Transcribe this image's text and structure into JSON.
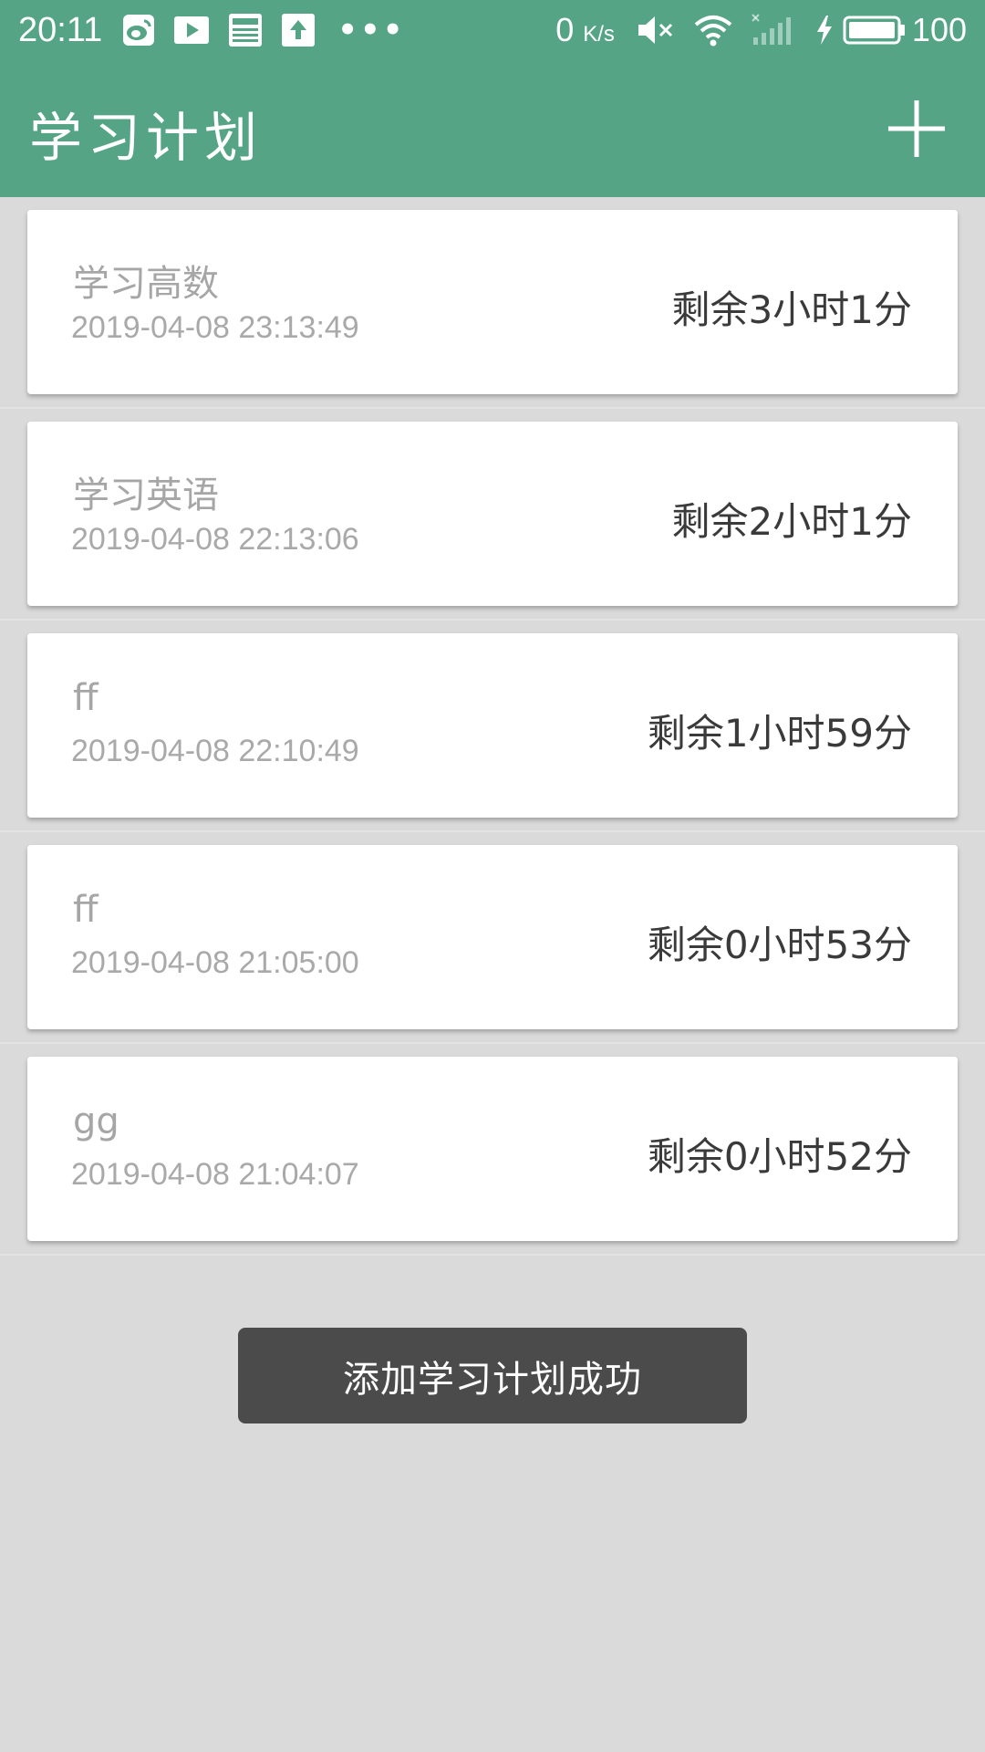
{
  "status_bar": {
    "time": "20:11",
    "icons_left": [
      "weibo-icon",
      "video-icon",
      "news-icon",
      "upload-icon"
    ],
    "more": "•••",
    "net_speed_value": "0",
    "net_speed_unit": "K/s",
    "icons_right": [
      "mute-icon",
      "wifi-icon",
      "signal-icon",
      "charging-icon",
      "battery-icon"
    ],
    "battery": "100"
  },
  "app_bar": {
    "title": "学习计划",
    "add_icon": "plus-icon"
  },
  "plans": [
    {
      "title": "学习高数",
      "time": "2019-04-08 23:13:49",
      "remaining": "剩余3小时1分"
    },
    {
      "title": "学习英语",
      "time": "2019-04-08 22:13:06",
      "remaining": "剩余2小时1分"
    },
    {
      "title": "ff",
      "time": "2019-04-08 22:10:49",
      "remaining": "剩余1小时59分"
    },
    {
      "title": "ff",
      "time": "2019-04-08 21:05:00",
      "remaining": "剩余0小时53分"
    },
    {
      "title": "gg",
      "time": "2019-04-08 21:04:07",
      "remaining": "剩余0小时52分"
    }
  ],
  "toast": {
    "message": "添加学习计划成功"
  },
  "colors": {
    "primary": "#55a486",
    "background": "#dadada",
    "card": "#ffffff",
    "toast": "#4b4b4b"
  }
}
